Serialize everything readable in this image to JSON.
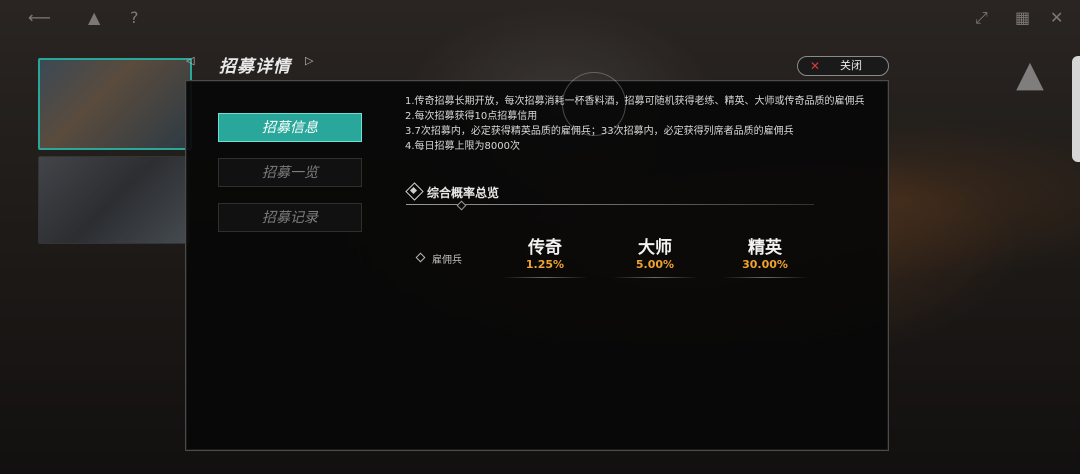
{
  "topbar": {
    "icons": [
      "back-icon",
      "home-icon",
      "help-icon"
    ],
    "right_icons": [
      "fullscreen-icon",
      "settings-icon",
      "close-icon"
    ]
  },
  "panel": {
    "title": "招募详情",
    "close_label": "关闭",
    "tabs": [
      {
        "label": "招募信息",
        "active": true
      },
      {
        "label": "招募一览",
        "active": false
      },
      {
        "label": "招募记录",
        "active": false
      }
    ],
    "info_lines": [
      "1.传奇招募长期开放，每次招募消耗一杯香料酒，招募可随机获得老练、精英、大师或传奇品质的雇佣兵",
      "2.每次招募获得10点招募信用",
      "3.7次招募内，必定获得精英品质的雇佣兵；33次招募内，必定获得列席者品质的雇佣兵",
      "4.每日招募上限为8000次"
    ],
    "section_title": "综合概率总览",
    "row_label": "雇佣兵",
    "rates": [
      {
        "name": "传奇",
        "value": "1.25%"
      },
      {
        "name": "大师",
        "value": "5.00%"
      },
      {
        "name": "精英",
        "value": "30.00%"
      }
    ]
  },
  "colors": {
    "accent": "#2aa79b",
    "rate_value": "#f0a22e",
    "close_x": "#d93a3a"
  }
}
